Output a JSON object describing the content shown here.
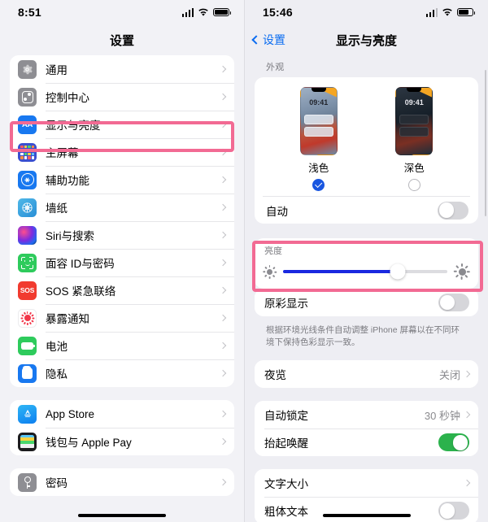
{
  "left": {
    "status": {
      "time": "8:51",
      "signal_icon": "cellular-signal-icon",
      "wifi_icon": "wifi-icon",
      "battery_icon": "battery-icon"
    },
    "nav": {
      "title": "设置"
    },
    "groups": [
      {
        "items": [
          {
            "label": "通用",
            "icon": "gear-icon"
          },
          {
            "label": "控制中心",
            "icon": "control-center-icon"
          },
          {
            "label": "显示与亮度",
            "icon": "display-brightness-icon",
            "highlighted": true
          },
          {
            "label": "主屏幕",
            "icon": "home-screen-icon"
          },
          {
            "label": "辅助功能",
            "icon": "accessibility-icon"
          },
          {
            "label": "墙纸",
            "icon": "wallpaper-icon"
          },
          {
            "label": "Siri与搜索",
            "icon": "siri-icon"
          },
          {
            "label": "面容 ID与密码",
            "icon": "face-id-icon"
          },
          {
            "label": "SOS 紧急联络",
            "icon": "sos-icon"
          },
          {
            "label": "暴露通知",
            "icon": "exposure-notification-icon"
          },
          {
            "label": "电池",
            "icon": "battery-settings-icon"
          },
          {
            "label": "隐私",
            "icon": "privacy-icon"
          }
        ]
      },
      {
        "items": [
          {
            "label": "App Store",
            "icon": "app-store-icon"
          },
          {
            "label": "钱包与 Apple Pay",
            "icon": "wallet-icon"
          }
        ]
      },
      {
        "items": [
          {
            "label": "密码",
            "icon": "passwords-icon"
          }
        ]
      }
    ]
  },
  "right": {
    "status": {
      "time": "15:46",
      "signal_icon": "cellular-signal-icon",
      "wifi_icon": "wifi-icon",
      "battery_icon": "battery-icon"
    },
    "nav": {
      "back_label": "设置",
      "title": "显示与亮度"
    },
    "appearance": {
      "section_title": "外观",
      "options": [
        {
          "caption": "浅色",
          "thumb_time": "09:41",
          "selected": true
        },
        {
          "caption": "深色",
          "thumb_time": "09:41",
          "selected": false
        }
      ],
      "auto_label": "自动",
      "auto_on": false
    },
    "brightness": {
      "section_title": "亮度",
      "value_percent": 70,
      "low_icon": "brightness-low-icon",
      "high_icon": "brightness-high-icon",
      "highlighted": true,
      "true_tone_label": "原彩显示",
      "true_tone_on": false,
      "footnote": "根据环境光线条件自动调整 iPhone 屏幕以在不同环境下保持色彩显示一致。"
    },
    "night_shift": {
      "label": "夜览",
      "value": "关闭"
    },
    "lock": {
      "auto_lock_label": "自动锁定",
      "auto_lock_value": "30 秒钟",
      "raise_to_wake_label": "抬起唤醒",
      "raise_to_wake_on": true
    },
    "text": {
      "text_size_label": "文字大小",
      "bold_text_label": "粗体文本",
      "bold_text_on": false
    }
  },
  "colors": {
    "highlight": "#f26a93",
    "accent_blue": "#1878f0",
    "slider_blue": "#1a29e0",
    "toggle_green": "#2bb24c"
  }
}
